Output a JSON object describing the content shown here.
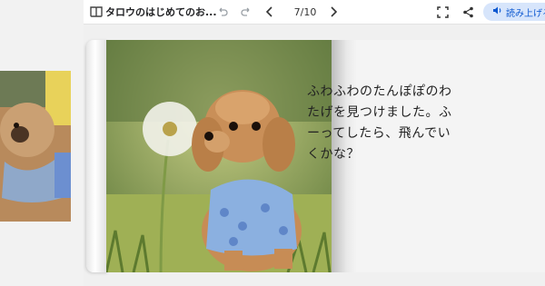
{
  "toolbar": {
    "title": "タロウのはじめてのお...",
    "page_indicator": "7/10",
    "read_aloud_label": "読み上げる"
  },
  "icons": {
    "book": "book-icon",
    "undo": "undo-icon",
    "redo": "redo-icon",
    "prev": "chevron-left-icon",
    "next": "chevron-right-icon",
    "fullscreen": "fullscreen-icon",
    "share": "share-icon",
    "speaker": "speaker-icon"
  },
  "book": {
    "text": "ふわふわのたんぽぽのわたげを見つけました。ふーってしたら、飛んでいくかな？"
  },
  "colors": {
    "accent": "#0b57d0",
    "accent_bg": "#d7e5fb"
  }
}
